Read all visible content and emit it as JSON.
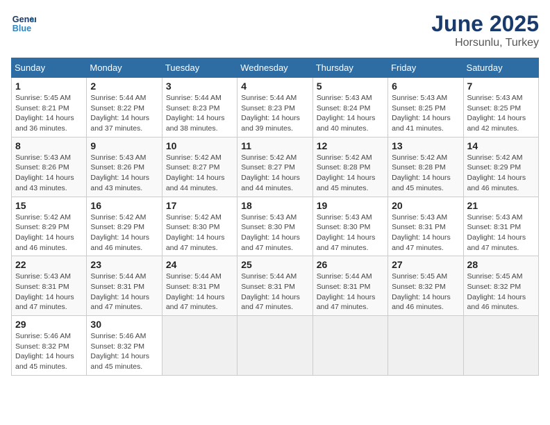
{
  "header": {
    "logo_line1": "General",
    "logo_line2": "Blue",
    "title": "June 2025",
    "subtitle": "Horsunlu, Turkey"
  },
  "weekdays": [
    "Sunday",
    "Monday",
    "Tuesday",
    "Wednesday",
    "Thursday",
    "Friday",
    "Saturday"
  ],
  "weeks": [
    [
      {
        "day": "1",
        "info": "Sunrise: 5:45 AM\nSunset: 8:21 PM\nDaylight: 14 hours\nand 36 minutes."
      },
      {
        "day": "2",
        "info": "Sunrise: 5:44 AM\nSunset: 8:22 PM\nDaylight: 14 hours\nand 37 minutes."
      },
      {
        "day": "3",
        "info": "Sunrise: 5:44 AM\nSunset: 8:23 PM\nDaylight: 14 hours\nand 38 minutes."
      },
      {
        "day": "4",
        "info": "Sunrise: 5:44 AM\nSunset: 8:23 PM\nDaylight: 14 hours\nand 39 minutes."
      },
      {
        "day": "5",
        "info": "Sunrise: 5:43 AM\nSunset: 8:24 PM\nDaylight: 14 hours\nand 40 minutes."
      },
      {
        "day": "6",
        "info": "Sunrise: 5:43 AM\nSunset: 8:25 PM\nDaylight: 14 hours\nand 41 minutes."
      },
      {
        "day": "7",
        "info": "Sunrise: 5:43 AM\nSunset: 8:25 PM\nDaylight: 14 hours\nand 42 minutes."
      }
    ],
    [
      {
        "day": "8",
        "info": "Sunrise: 5:43 AM\nSunset: 8:26 PM\nDaylight: 14 hours\nand 43 minutes."
      },
      {
        "day": "9",
        "info": "Sunrise: 5:43 AM\nSunset: 8:26 PM\nDaylight: 14 hours\nand 43 minutes."
      },
      {
        "day": "10",
        "info": "Sunrise: 5:42 AM\nSunset: 8:27 PM\nDaylight: 14 hours\nand 44 minutes."
      },
      {
        "day": "11",
        "info": "Sunrise: 5:42 AM\nSunset: 8:27 PM\nDaylight: 14 hours\nand 44 minutes."
      },
      {
        "day": "12",
        "info": "Sunrise: 5:42 AM\nSunset: 8:28 PM\nDaylight: 14 hours\nand 45 minutes."
      },
      {
        "day": "13",
        "info": "Sunrise: 5:42 AM\nSunset: 8:28 PM\nDaylight: 14 hours\nand 45 minutes."
      },
      {
        "day": "14",
        "info": "Sunrise: 5:42 AM\nSunset: 8:29 PM\nDaylight: 14 hours\nand 46 minutes."
      }
    ],
    [
      {
        "day": "15",
        "info": "Sunrise: 5:42 AM\nSunset: 8:29 PM\nDaylight: 14 hours\nand 46 minutes."
      },
      {
        "day": "16",
        "info": "Sunrise: 5:42 AM\nSunset: 8:29 PM\nDaylight: 14 hours\nand 46 minutes."
      },
      {
        "day": "17",
        "info": "Sunrise: 5:42 AM\nSunset: 8:30 PM\nDaylight: 14 hours\nand 47 minutes."
      },
      {
        "day": "18",
        "info": "Sunrise: 5:43 AM\nSunset: 8:30 PM\nDaylight: 14 hours\nand 47 minutes."
      },
      {
        "day": "19",
        "info": "Sunrise: 5:43 AM\nSunset: 8:30 PM\nDaylight: 14 hours\nand 47 minutes."
      },
      {
        "day": "20",
        "info": "Sunrise: 5:43 AM\nSunset: 8:31 PM\nDaylight: 14 hours\nand 47 minutes."
      },
      {
        "day": "21",
        "info": "Sunrise: 5:43 AM\nSunset: 8:31 PM\nDaylight: 14 hours\nand 47 minutes."
      }
    ],
    [
      {
        "day": "22",
        "info": "Sunrise: 5:43 AM\nSunset: 8:31 PM\nDaylight: 14 hours\nand 47 minutes."
      },
      {
        "day": "23",
        "info": "Sunrise: 5:44 AM\nSunset: 8:31 PM\nDaylight: 14 hours\nand 47 minutes."
      },
      {
        "day": "24",
        "info": "Sunrise: 5:44 AM\nSunset: 8:31 PM\nDaylight: 14 hours\nand 47 minutes."
      },
      {
        "day": "25",
        "info": "Sunrise: 5:44 AM\nSunset: 8:31 PM\nDaylight: 14 hours\nand 47 minutes."
      },
      {
        "day": "26",
        "info": "Sunrise: 5:44 AM\nSunset: 8:31 PM\nDaylight: 14 hours\nand 47 minutes."
      },
      {
        "day": "27",
        "info": "Sunrise: 5:45 AM\nSunset: 8:32 PM\nDaylight: 14 hours\nand 46 minutes."
      },
      {
        "day": "28",
        "info": "Sunrise: 5:45 AM\nSunset: 8:32 PM\nDaylight: 14 hours\nand 46 minutes."
      }
    ],
    [
      {
        "day": "29",
        "info": "Sunrise: 5:46 AM\nSunset: 8:32 PM\nDaylight: 14 hours\nand 45 minutes."
      },
      {
        "day": "30",
        "info": "Sunrise: 5:46 AM\nSunset: 8:32 PM\nDaylight: 14 hours\nand 45 minutes."
      },
      {
        "day": "",
        "info": ""
      },
      {
        "day": "",
        "info": ""
      },
      {
        "day": "",
        "info": ""
      },
      {
        "day": "",
        "info": ""
      },
      {
        "day": "",
        "info": ""
      }
    ]
  ]
}
